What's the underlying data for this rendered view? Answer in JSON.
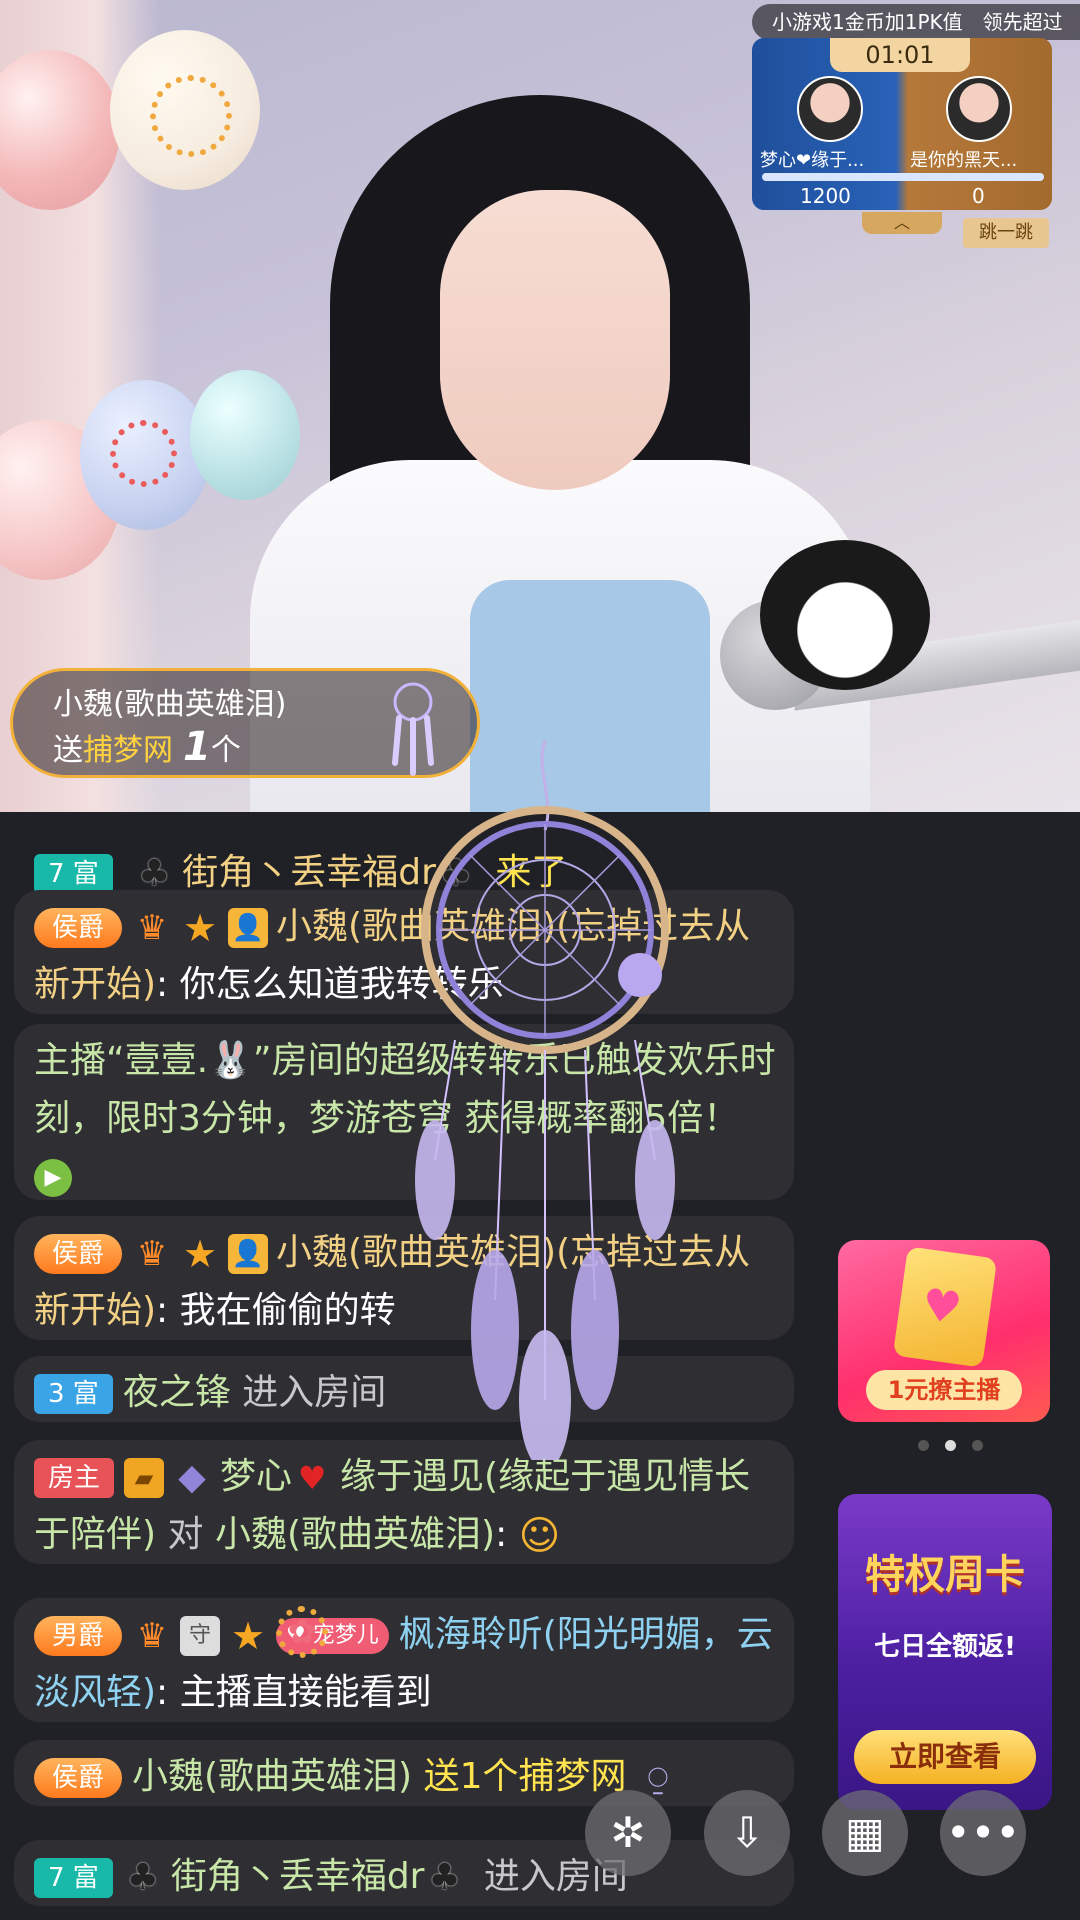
{
  "pk": {
    "promo_text": "小游戏1金币加1PK值　领先超过",
    "timer": "01:01",
    "left_name": "梦心❤缘于...",
    "right_name": "是你的黑天...",
    "left_score": "1200",
    "right_score": "0",
    "left_share": 1.0,
    "jump_label": "跳一跳",
    "toggle_icon": "chevron-up-icon"
  },
  "gift_banner": {
    "sender": "小魏(歌曲英雄泪)",
    "send_word": "送",
    "gift_name": "捕梦网",
    "count": "1",
    "unit": "个"
  },
  "chat": [
    {
      "badge": "7 富",
      "name": "街角丶丢幸福dr",
      "action": "来了"
    },
    {
      "badge": "侯爵",
      "name": "小魏(歌曲英雄泪)(忘掉过去从新开始)",
      "text": "你怎么知道我转转乐"
    },
    {
      "text": "主播“壹壹.🐰”房间的超级转转乐已触发欢乐时刻，限时3分钟，梦游苍穹 获得概率翻5倍！"
    },
    {
      "badge": "侯爵",
      "name": "小魏(歌曲英雄泪)(忘掉过去从新开始)",
      "text": "我在偷偷的转"
    },
    {
      "badge": "3 富",
      "name": "夜之锋",
      "action": "进入房间"
    },
    {
      "badge": "房主",
      "name": "梦心",
      "name_rest": "缘于遇见(缘起于遇见情长于陪伴)",
      "to": "对",
      "target": "小魏(歌曲英雄泪)"
    },
    {
      "badge": "男爵",
      "pet": "宠梦儿",
      "name": "枫海聆听(阳光明媚，云淡风轻)",
      "text": "主播直接能看到"
    },
    {
      "badge": "侯爵",
      "name": "小魏(歌曲英雄泪)",
      "text": "送1个捕梦网"
    },
    {
      "badge": "7 富",
      "name": "街角丶丢幸福dr",
      "action": "进入房间"
    }
  ],
  "promos": {
    "promo1_label": "1元撩主播",
    "promo2_title": "特权周卡",
    "promo2_sub": "七日全额返!",
    "promo2_button": "立即查看"
  },
  "toolbar": {
    "icons": [
      "sparkle-icon",
      "download-icon",
      "grid-icon",
      "more-icon"
    ]
  },
  "colors": {
    "chat_bubble": "#2e2e33",
    "name_gold": "#f2d084",
    "pk_blue": "#2962b8",
    "pk_gold": "#b5793a",
    "rich_badge": "#19b9a9",
    "rank_badge": "#ff7a1e"
  }
}
